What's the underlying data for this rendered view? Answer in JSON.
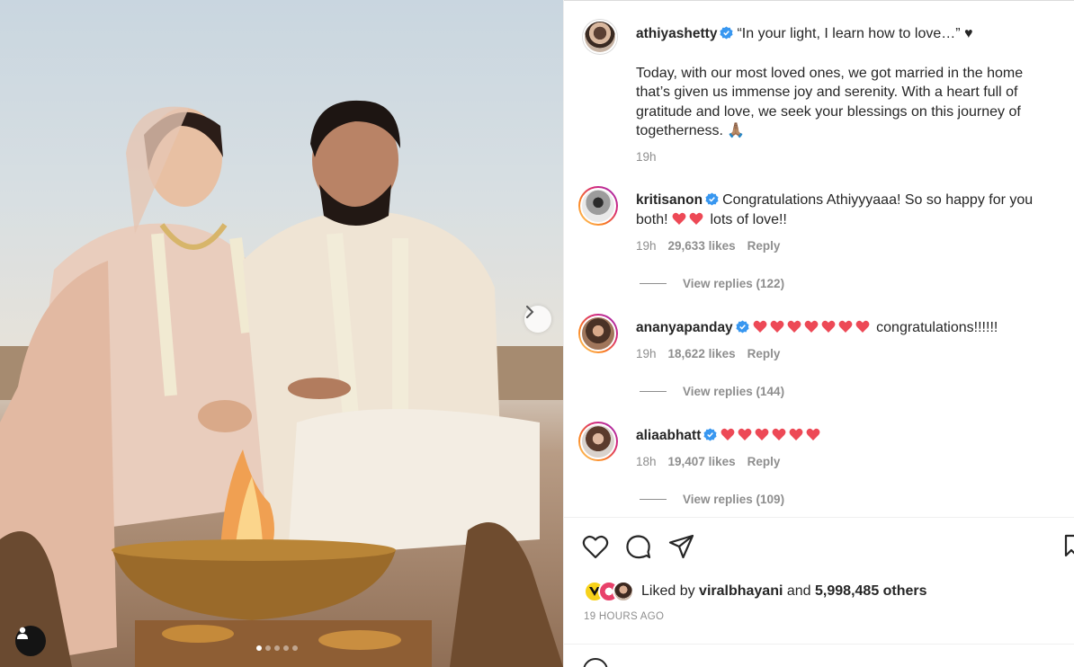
{
  "post": {
    "author": "athiyashetty",
    "caption_line1": "“In your light, I learn how to love…” ♥︎",
    "caption_body": "Today, with our most loved ones, we got married in the home that’s given us immense joy and serenity. With a heart full of gratitude and love, we seek your blessings on this journey of togetherness. 🙏🏽",
    "time": "19h"
  },
  "comments": [
    {
      "username": "kritisanon",
      "text_before": "Congratulations Athiyyyaaa! So so happy for you both!",
      "hearts": 2,
      "text_after": "lots of love!!",
      "time": "19h",
      "likes": "29,633 likes",
      "reply": "Reply",
      "view_replies": "View replies (122)"
    },
    {
      "username": "ananyapanday",
      "hearts": 7,
      "text_after": "congratulations!!!!!!",
      "time": "19h",
      "likes": "18,622 likes",
      "reply": "Reply",
      "view_replies": "View replies (144)"
    },
    {
      "username": "aliaabhatt",
      "hearts": 6,
      "time": "18h",
      "likes": "19,407 likes",
      "reply": "Reply",
      "view_replies": "View replies (109)"
    }
  ],
  "likes": {
    "prefix": "Liked by",
    "user": "viralbhayani",
    "connector": "and",
    "others": "5,998,485 others"
  },
  "timestamp": "19 HOURS AGO",
  "icons": [
    "heart-icon",
    "comment-icon",
    "share-icon",
    "bookmark-icon",
    "verified-badge-icon",
    "chevron-right-icon",
    "user-tag-icon"
  ],
  "colors": {
    "verified": "#3897f0",
    "heart": "#ed4956",
    "muted": "#8e8e8e",
    "text": "#262626"
  },
  "carousel": {
    "total": 5,
    "active": 1
  }
}
